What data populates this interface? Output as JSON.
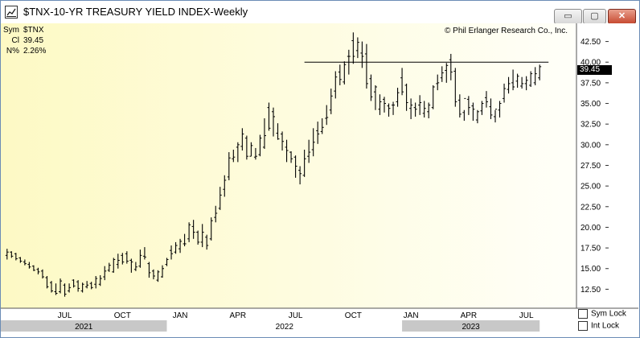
{
  "window": {
    "title": "$TNX-10-YR TREASURY YIELD INDEX-Weekly",
    "controls": {
      "minimize": "▭",
      "maximize": "▢",
      "close": "✕"
    }
  },
  "info": {
    "sym_label": "Sym",
    "sym_value": "$TNX",
    "cl_label": "Cl",
    "cl_value": "39.45",
    "pct_label": "N%",
    "pct_value": "2.26%"
  },
  "copyright": "© Phil Erlanger Research Co., Inc.",
  "last_value": "39.45",
  "checkboxes": {
    "sym_lock": "Sym Lock",
    "int_lock": "Int Lock"
  },
  "colors": {
    "bg_left": "#fdf9c4",
    "bg_right": "#fffff9",
    "bar": "#000000",
    "resistance": "#000000",
    "year_band_dark": "#c8c8c8",
    "year_band_light": "#ffffff"
  },
  "chart_data": {
    "type": "bar",
    "style": "ohlc",
    "ylim": [
      10.2,
      44.7
    ],
    "yticks": [
      12.5,
      15.0,
      17.5,
      20.0,
      22.5,
      25.0,
      27.5,
      30.0,
      32.5,
      35.0,
      37.5,
      40.0,
      42.5
    ],
    "ytick_labels": [
      "12.50",
      "15.00",
      "17.50",
      "20.00",
      "22.50",
      "25.00",
      "27.50",
      "30.00",
      "32.50",
      "35.00",
      "37.50",
      "40.00",
      "42.50"
    ],
    "month_ticks": [
      {
        "label": "JUL",
        "index": 13
      },
      {
        "label": "OCT",
        "index": 26
      },
      {
        "label": "JAN",
        "index": 39
      },
      {
        "label": "APR",
        "index": 52
      },
      {
        "label": "JUL",
        "index": 65
      },
      {
        "label": "OCT",
        "index": 78
      },
      {
        "label": "JAN",
        "index": 91
      },
      {
        "label": "APR",
        "index": 104
      },
      {
        "label": "JUL",
        "index": 117
      }
    ],
    "years": [
      {
        "label": "2021",
        "start": -2,
        "end": 36
      },
      {
        "label": "2022",
        "start": 36,
        "end": 89
      },
      {
        "label": "2023",
        "start": 89,
        "end": 120
      }
    ],
    "resistance": {
      "value": 40.0,
      "start": 67,
      "end": 122
    },
    "high": [
      17.4,
      17.1,
      16.9,
      16.4,
      16.1,
      15.8,
      15.4,
      15.1,
      14.9,
      14.1,
      13.5,
      13.2,
      13.8,
      13.2,
      13.2,
      13.7,
      13.6,
      13.3,
      13.5,
      13.4,
      14.1,
      14.2,
      15.3,
      15.7,
      16.3,
      16.8,
      16.9,
      17.1,
      16.2,
      15.8,
      17.3,
      17.6,
      15.8,
      14.9,
      14.8,
      15.4,
      16.3,
      17.8,
      18.2,
      18.6,
      19.2,
      20.6,
      20.9,
      19.6,
      20.4,
      19.1,
      21.2,
      22.6,
      24.9,
      26.3,
      29.1,
      29.4,
      30.3,
      32.0,
      31.1,
      30.3,
      29.6,
      31.2,
      33.2,
      35.1,
      34.5,
      32.6,
      31.6,
      30.6,
      29.2,
      28.7,
      27.4,
      29.4,
      30.6,
      32.0,
      32.8,
      33.2,
      34.8,
      36.8,
      38.9,
      39.7,
      40.1,
      41.5,
      43.6,
      43.0,
      42.5,
      42.2,
      38.5,
      37.2,
      36.1,
      35.8,
      35.0,
      35.2,
      36.9,
      39.3,
      37.4,
      35.6,
      35.1,
      36.0,
      35.3,
      35.1,
      37.2,
      38.5,
      39.5,
      39.9,
      41.0,
      39.3,
      36.1,
      34.2,
      35.9,
      35.1,
      34.2,
      35.3,
      36.5,
      35.6,
      34.2,
      35.3,
      37.4,
      38.2,
      39.1,
      38.6,
      38.2,
      38.3,
      38.9,
      39.4,
      39.7
    ],
    "low": [
      16.1,
      16.3,
      16.0,
      15.7,
      15.4,
      15.0,
      14.7,
      14.3,
      13.8,
      12.6,
      12.1,
      11.8,
      12.0,
      11.6,
      12.1,
      12.7,
      12.2,
      12.1,
      12.6,
      12.5,
      12.6,
      12.9,
      13.6,
      14.6,
      14.5,
      15.0,
      15.5,
      15.6,
      14.5,
      14.7,
      15.1,
      16.1,
      13.9,
      13.7,
      13.4,
      13.9,
      15.3,
      16.1,
      16.8,
      16.9,
      17.7,
      18.2,
      18.6,
      17.9,
      17.6,
      17.3,
      18.4,
      20.6,
      22.1,
      23.7,
      25.7,
      27.9,
      27.9,
      29.3,
      28.2,
      28.6,
      28.2,
      28.6,
      29.5,
      31.7,
      31.0,
      30.6,
      29.3,
      27.9,
      27.8,
      26.0,
      25.2,
      26.1,
      27.8,
      28.6,
      30.1,
      31.3,
      32.4,
      33.7,
      35.6,
      37.2,
      37.3,
      38.5,
      39.8,
      40.5,
      39.3,
      36.8,
      35.3,
      34.2,
      33.6,
      33.9,
      33.4,
      33.6,
      34.6,
      36.0,
      34.1,
      33.1,
      33.4,
      33.6,
      33.3,
      33.2,
      34.3,
      36.6,
      37.6,
      37.5,
      37.8,
      34.6,
      33.3,
      32.9,
      33.6,
      32.9,
      32.6,
      33.6,
      34.5,
      33.1,
      32.7,
      33.3,
      35.1,
      36.2,
      36.6,
      36.9,
      36.8,
      36.6,
      37.0,
      37.2,
      37.8
    ],
    "open": [
      16.6,
      17.0,
      16.8,
      16.3,
      15.8,
      15.5,
      15.3,
      14.9,
      14.7,
      13.9,
      13.3,
      12.2,
      12.2,
      13.0,
      12.3,
      13.6,
      13.4,
      12.3,
      12.8,
      13.2,
      13.1,
      13.1,
      14.0,
      14.8,
      14.6,
      15.5,
      16.6,
      16.8,
      16.0,
      14.9,
      15.3,
      16.5,
      15.6,
      14.7,
      13.6,
      14.0,
      15.5,
      17.2,
      17.0,
      17.4,
      18.0,
      18.6,
      20.1,
      19.4,
      18.2,
      18.8,
      18.6,
      21.2,
      22.3,
      24.6,
      26.1,
      28.3,
      29.7,
      29.8,
      30.8,
      28.6,
      28.5,
      28.8,
      29.7,
      34.5,
      34.0,
      31.4,
      31.3,
      29.7,
      29.1,
      28.5,
      26.9,
      26.3,
      28.6,
      29.4,
      31.7,
      31.6,
      33.2,
      34.2,
      36.5,
      38.8,
      37.6,
      40.7,
      42.6,
      41.4,
      41.1,
      41.0,
      38.0,
      36.4,
      34.3,
      35.5,
      34.7,
      34.8,
      35.2,
      38.1,
      37.2,
      34.4,
      34.5,
      34.8,
      33.8,
      34.0,
      34.5,
      37.4,
      38.1,
      39.0,
      40.3,
      38.9,
      35.4,
      33.9,
      35.5,
      34.7,
      33.0,
      34.1,
      35.7,
      34.6,
      33.4,
      34.2,
      35.6,
      36.7,
      37.5,
      37.7,
      37.1,
      37.4,
      37.2,
      37.5,
      38.1
    ],
    "close": [
      17.0,
      16.5,
      16.2,
      15.9,
      15.6,
      15.2,
      14.8,
      14.6,
      14.0,
      12.8,
      12.3,
      12.0,
      13.5,
      11.9,
      12.7,
      12.9,
      12.6,
      13.1,
      13.0,
      12.7,
      13.8,
      13.8,
      14.7,
      15.4,
      16.1,
      16.0,
      15.8,
      15.9,
      15.8,
      15.2,
      16.6,
      16.4,
      14.5,
      14.1,
      14.6,
      15.0,
      16.1,
      16.8,
      17.8,
      18.3,
      18.0,
      20.3,
      19.4,
      18.2,
      19.4,
      17.8,
      20.8,
      21.7,
      23.9,
      25.7,
      28.4,
      28.5,
      30.0,
      31.3,
      28.6,
      29.9,
      28.6,
      30.8,
      31.1,
      32.0,
      33.4,
      30.7,
      30.4,
      29.3,
      28.3,
      27.4,
      26.5,
      28.3,
      29.1,
      30.3,
      31.3,
      32.1,
      33.3,
      35.9,
      38.2,
      37.9,
      39.7,
      40.7,
      40.7,
      42.4,
      40.7,
      37.4,
      35.8,
      37.0,
      35.2,
      35.0,
      34.4,
      34.8,
      36.3,
      36.4,
      35.1,
      34.8,
      34.3,
      35.1,
      34.4,
      34.8,
      37.0,
      37.5,
      38.7,
      39.6,
      38.8,
      35.2,
      33.7,
      35.6,
      34.5,
      34.3,
      34.0,
      35.0,
      35.2,
      33.6,
      34.3,
      35.0,
      36.8,
      37.4,
      37.0,
      38.3,
      37.4,
      37.8,
      38.6,
      38.6,
      39.45
    ]
  }
}
